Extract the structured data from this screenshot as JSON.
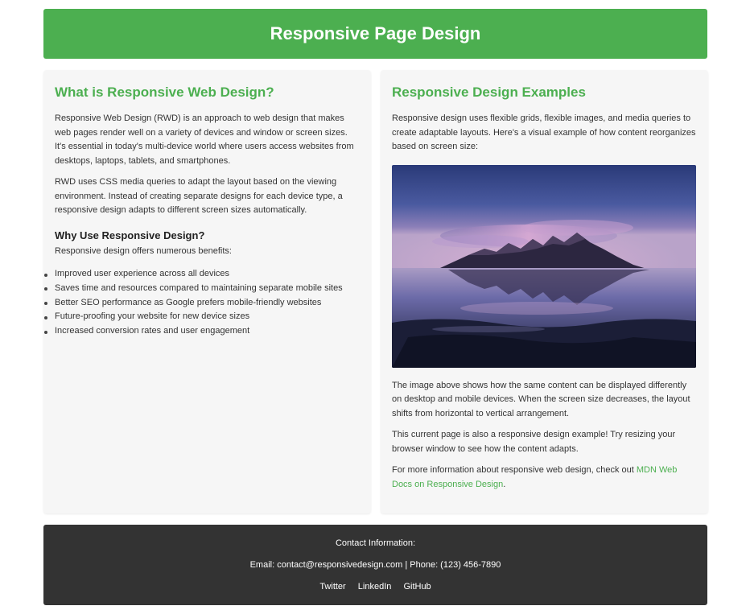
{
  "header": {
    "title": "Responsive Page Design"
  },
  "left": {
    "heading": "What is Responsive Web Design?",
    "para1": "Responsive Web Design (RWD) is an approach to web design that makes web pages render well on a variety of devices and window or screen sizes. It's essential in today's multi-device world where users access websites from desktops, laptops, tablets, and smartphones.",
    "para2": "RWD uses CSS media queries to adapt the layout based on the viewing environment. Instead of creating separate designs for each device type, a responsive design adapts to different screen sizes automatically.",
    "subheading": "Why Use Responsive Design?",
    "benefits_intro": "Responsive design offers numerous benefits:",
    "benefits": [
      "Improved user experience across all devices",
      "Saves time and resources compared to maintaining separate mobile sites",
      "Better SEO performance as Google prefers mobile-friendly websites",
      "Future-proofing your website for new device sizes",
      "Increased conversion rates and user engagement"
    ]
  },
  "right": {
    "heading": "Responsive Design Examples",
    "para1": "Responsive design uses flexible grids, flexible images, and media queries to create adaptable layouts. Here's a visual example of how content reorganizes based on screen size:",
    "para2": "The image above shows how the same content can be displayed differently on desktop and mobile devices. When the screen size decreases, the layout shifts from horizontal to vertical arrangement.",
    "para3": "This current page is also a responsive design example! Try resizing your browser window to see how the content adapts.",
    "para4_prefix": "For more information about responsive web design, check out ",
    "para4_link": "MDN Web Docs on Responsive Design",
    "para4_suffix": "."
  },
  "footer": {
    "contact_heading": "Contact Information:",
    "contact_line": "Email: contact@responsivedesign.com | Phone: (123) 456-7890",
    "links": [
      "Twitter",
      "LinkedIn",
      "GitHub"
    ]
  },
  "colors": {
    "accent": "#4caf50",
    "panel_bg": "#f6f6f6",
    "footer_bg": "#333333"
  }
}
